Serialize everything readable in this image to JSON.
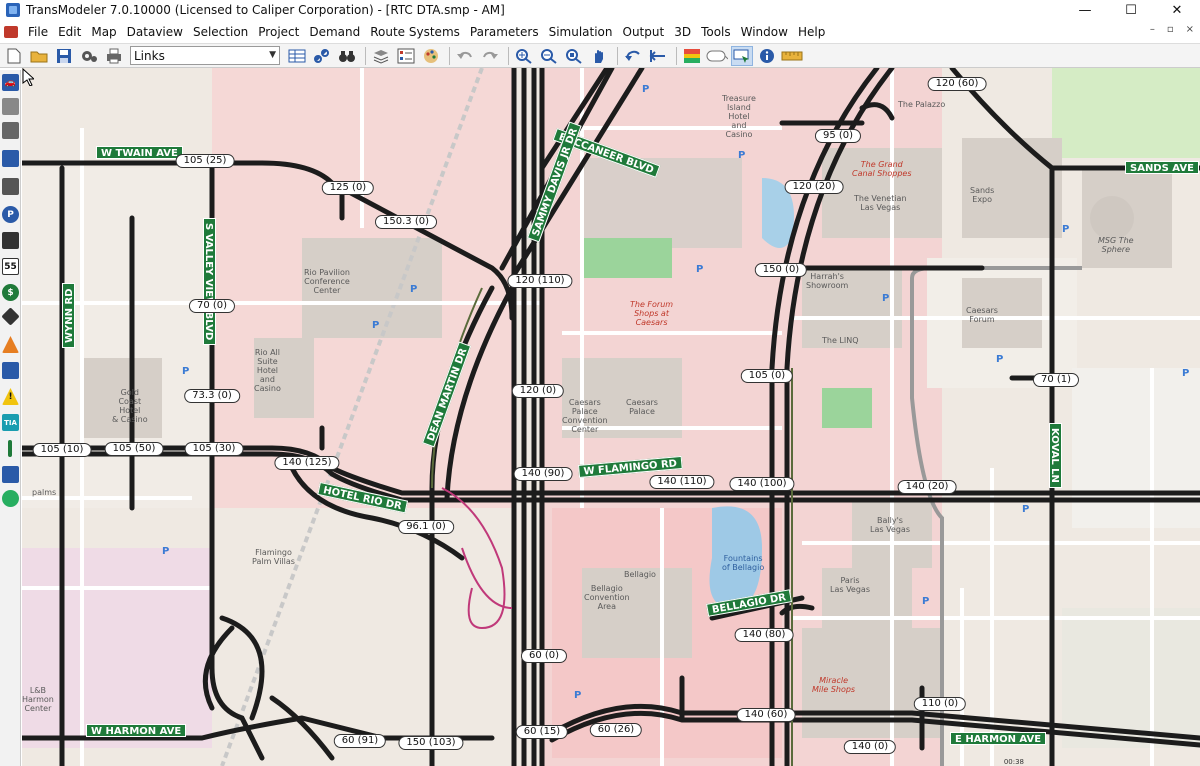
{
  "window": {
    "title": "TransModeler 7.0.10000 (Licensed to Caliper Corporation) - [RTC DTA.smp - AM]",
    "minimize": "—",
    "maximize": "☐",
    "close": "✕"
  },
  "menu": [
    "File",
    "Edit",
    "Map",
    "Dataview",
    "Selection",
    "Project",
    "Demand",
    "Route Systems",
    "Parameters",
    "Simulation",
    "Output",
    "3D",
    "Tools",
    "Window",
    "Help"
  ],
  "toolbar": {
    "layer": "Links"
  },
  "palette": {
    "speed_label": "55",
    "tia_label": "TIA",
    "p_label": "P",
    "dollar_label": "$"
  },
  "streets": {
    "twain": "W TWAIN AVE",
    "valley_view": "S VALLEY VIEW BLVD",
    "wynn": "WYNN RD",
    "buccaneer": "BUCCANEER BLVD",
    "sammy_davis": "SAMMY DAVIS JR DR",
    "sands": "SANDS AVE",
    "dean_martin": "DEAN MARTIN DR",
    "hotel_rio": "HOTEL RIO DR",
    "flamingo": "W FLAMINGO RD",
    "koval": "KOVAL LN",
    "bellagio": "BELLAGIO DR",
    "harmon_w": "W HARMON AVE",
    "harmon_e": "E HARMON AVE"
  },
  "link_labels": {
    "l1": "120 (60)",
    "l2": "95 (0)",
    "l3": "105 (25)",
    "l4": "125 (0)",
    "l5": "120 (20)",
    "l6": "150.3 (0)",
    "l7": "150 (0)",
    "l8": "120 (110)",
    "l9": "70 (0)",
    "l10": "105 (0)",
    "l11": "70 (1)",
    "l12": "120 (0)",
    "l13": "73.3 (0)",
    "l14": "105 (10)",
    "l15": "105 (50)",
    "l16": "105 (30)",
    "l17": "140 (125)",
    "l18": "140 (90)",
    "l19": "140 (110)",
    "l20": "140 (100)",
    "l21": "140 (20)",
    "l22": "96.1 (0)",
    "l23": "140 (80)",
    "l24": "60 (0)",
    "l25": "110 (0)",
    "l26": "140 (60)",
    "l27": "60 (91)",
    "l28": "150 (103)",
    "l29": "60 (15)",
    "l30": "60 (26)",
    "l31": "140 (0)"
  },
  "places": {
    "treasure_island": "Treasure\nIsland\nHotel\nand\nCasino",
    "palazzo": "The Palazzo",
    "grand_canal": "The Grand\nCanal Shoppes",
    "venetian": "The Venetian\nLas Vegas",
    "sands_expo": "Sands\nExpo",
    "msg_sphere": "MSG The\nSphere",
    "rio_pavilion": "Rio Pavilion\nConference\nCenter",
    "rio_suite": "Rio All\nSuite\nHotel\nand\nCasino",
    "forum_shops": "The Forum\nShops at\nCaesars",
    "harrahs": "Harrah's\nShowroom",
    "caesars_forum": "Caesars\nForum",
    "the_linq": "The LINQ",
    "caesars_palace": "Caesars\nPalace",
    "convention_center": "Caesars\nPalace\nConvention\nCenter",
    "gold_coast": "Gold\nCoast\nHotel\n& Casino",
    "ballys": "Bally's\nLas Vegas",
    "paris": "Paris\nLas Vegas",
    "bellagio_center": "Bellagio\nConvention\nArea",
    "bellagio": "Bellagio",
    "miracle_mile": "Miracle\nMile Shops",
    "flamingo_palm": "Flamingo\nPalm Villas",
    "palms": "palms",
    "lb_harmon": "L&B\nHarmon\nCenter",
    "fountains": "Fountains\nof Bellagio"
  },
  "status": {
    "clock": "00:38"
  }
}
